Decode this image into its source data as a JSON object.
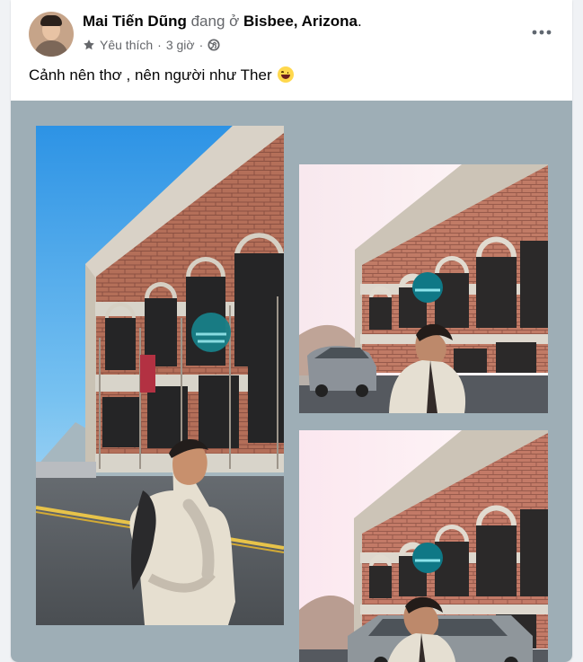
{
  "post": {
    "author_name": "Mai Tiến Dũng",
    "status_text": "đang ở",
    "location": "Bisbee, Arizona",
    "location_suffix": ".",
    "meta_label": "Yêu thích",
    "separator": "·",
    "time_ago": "3 giờ",
    "separator_2": "·",
    "caption": "Cảnh nên thơ , nên người như Ther"
  },
  "icons": {
    "favorite": "star-icon",
    "privacy": "globe-icon",
    "more": "more-options-icon",
    "emoji": "laughing-emoji-icon"
  },
  "colors": {
    "media_background": "#9eaeb6",
    "secondary_text": "#65676b",
    "text": "#050505"
  },
  "media": {
    "photos": [
      "large-street-photo",
      "upper-right-street-photo",
      "lower-right-street-photo"
    ]
  }
}
